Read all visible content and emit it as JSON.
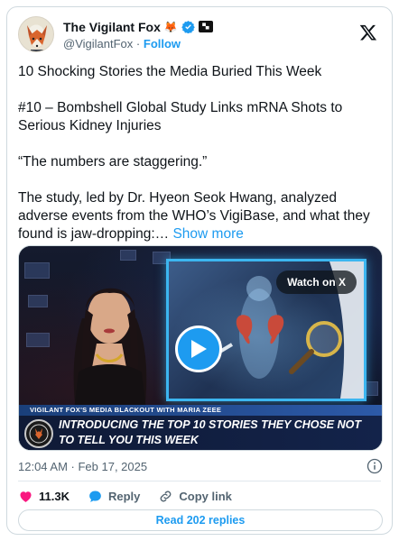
{
  "author": {
    "display_name": "The Vigilant Fox",
    "badge_emoji": "🦊",
    "handle": "@VigilantFox",
    "separator": "·",
    "follow_label": "Follow"
  },
  "post": {
    "lines": [
      "10 Shocking Stories the Media Buried This Week",
      "#10 – Bombshell Global Study Links mRNA Shots to Serious Kidney Injuries",
      "“The numbers are staggering.”",
      "The study, led by Dr. Hyeon Seok Hwang, analyzed adverse events from the WHO’s VigiBase, and what they found is jaw-dropping:…"
    ],
    "show_more": "Show more"
  },
  "media": {
    "watch_label": "Watch on X",
    "lower_third_top": "VIGILANT FOX'S MEDIA BLACKOUT WITH MARIA ZEEE",
    "headline": "INTRODUCING THE TOP 10 STORIES THEY CHOSE NOT TO TELL YOU THIS WEEK"
  },
  "meta": {
    "timestamp": "12:04 AM · Feb 17, 2025"
  },
  "actions": {
    "likes": "11.3K",
    "reply_label": "Reply",
    "copy_link_label": "Copy link"
  },
  "read_replies": "Read 202 replies",
  "colors": {
    "accent": "#1d9bf0",
    "like": "#f91880",
    "text": "#0f1419",
    "muted": "#536471"
  }
}
